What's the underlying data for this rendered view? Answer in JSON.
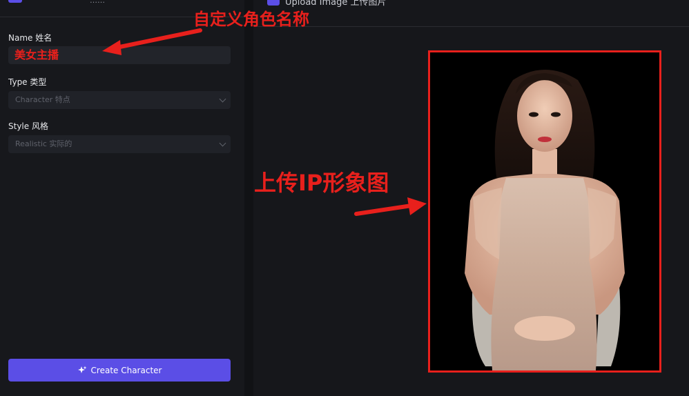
{
  "left": {
    "header_title": "……",
    "name_label": "Name 姓名",
    "name_value": "美女主播",
    "type_label": "Type 类型",
    "type_value": "Character 特点",
    "style_label": "Style 风格",
    "style_value": "Realistic 实际的",
    "create_button": "Create Character"
  },
  "right": {
    "upload_label": "Upload Image 上传图片"
  },
  "annotations": {
    "name_callout": "自定义角色名称",
    "upload_callout": "上传IP形象图"
  },
  "colors": {
    "accent": "#5b4ee6",
    "annotation_red": "#e8201c",
    "panel_bg": "#17181c"
  },
  "icons": {
    "sparkle": "sparkle-icon",
    "chevron": "chevron-down-icon",
    "image": "image-icon"
  }
}
